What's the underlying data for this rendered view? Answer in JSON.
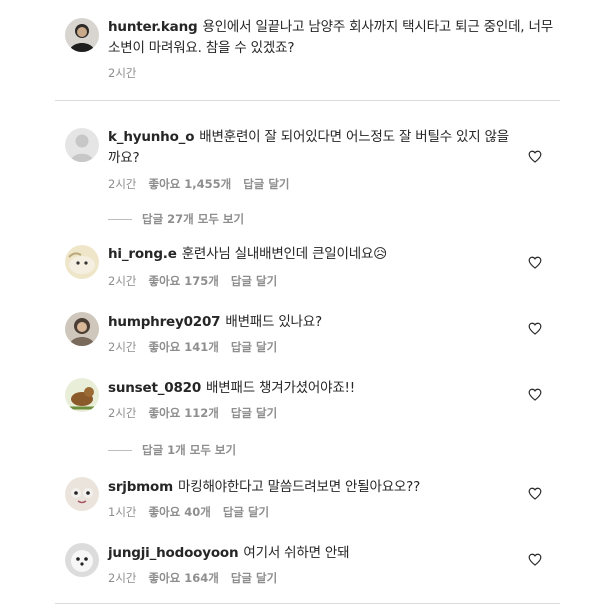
{
  "caption": {
    "username": "hunter.kang",
    "text": "용인에서 일끝나고 남양주 회사까지 택시타고 퇴근 중인데, 너무 소변이 마려워요. 참을 수 있겠죠?",
    "time": "2시간"
  },
  "labels": {
    "reply": "답글 달기"
  },
  "comments": [
    {
      "username": "k_hyunho_o",
      "text": "배변훈련이 잘 되어있다면 어느정도 잘 버틸수 있지 않을까요?",
      "time": "2시간",
      "likes": "좋아요 1,455개"
    },
    {
      "username": "hi_rong.e",
      "text": "훈련사님 실내배변인데 큰일이네요😥",
      "time": "2시간",
      "likes": "좋아요 175개"
    },
    {
      "username": "humphrey0207",
      "text": "배변패드 있나요?",
      "time": "2시간",
      "likes": "좋아요 141개"
    },
    {
      "username": "sunset_0820",
      "text": "배변패드 챙겨가셨어야죠!!",
      "time": "2시간",
      "likes": "좋아요 112개"
    },
    {
      "username": "srjbmom",
      "text": "마킹해야한다고 말씀드려보면 안될아요오??",
      "time": "1시간",
      "likes": "좋아요 40개"
    },
    {
      "username": "jungji_hodooyoon",
      "text": "여기서 쉬하면 안돼",
      "time": "2시간",
      "likes": "좋아요 164개"
    }
  ],
  "view_replies": [
    {
      "label": "답글 27개 모두 보기"
    },
    {
      "label": "답글 1개 모두 보기"
    }
  ],
  "colors": {
    "text": "#262626",
    "meta": "#8e8e8e",
    "divider": "#dbdbdb"
  },
  "icons": {
    "like": "heart-icon"
  }
}
